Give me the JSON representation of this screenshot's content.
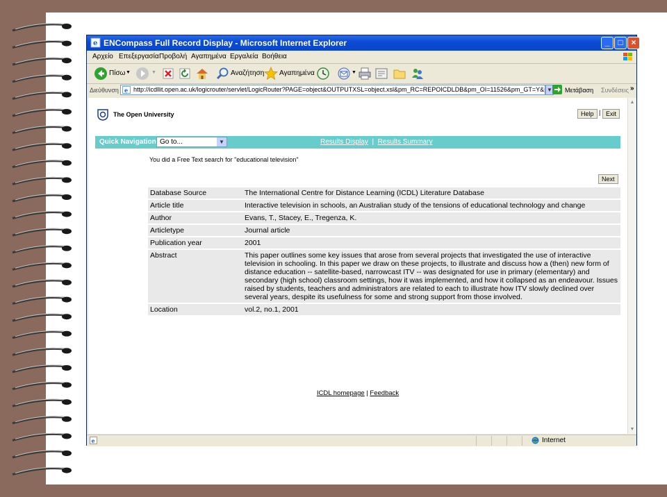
{
  "window": {
    "title": "ENCompass Full Record Display - Microsoft Internet Explorer"
  },
  "menu": [
    "Αρχείο",
    "Επεξεργασία",
    "Προβολή",
    "Αγαπημένα",
    "Εργαλεία",
    "Βοήθεια"
  ],
  "toolbar": {
    "back_label": "Πίσω",
    "search_label": "Αναζήτηση",
    "favorites_label": "Αγαπημένα"
  },
  "address": {
    "label": "Διεύθυνση",
    "url": "http://icdllit.open.ac.uk/logicrouter/servlet/LogicRouter?PAGE=object&OUTPUTXSL=object.xsl&pm_RC=REPOICDLDB&pm_OI=11526&pm_GT=Y&pm_IAC=Y",
    "go_label": "Μετάβαση",
    "links_label": "Συνδέσεις",
    "more_label": "»"
  },
  "header": {
    "org_name": "The Open University",
    "help_label": "Help",
    "exit_label": "Exit",
    "btn_separator": "|"
  },
  "quicknav": {
    "label": "Quick Navigation:",
    "select_value": "Go to...",
    "link_results_display": "Results Display",
    "link_separator": "|",
    "link_results_summary": "Results Summary"
  },
  "search_message": "You did a Free Text search for \"educational television\"",
  "next_label": "Next",
  "record": [
    {
      "field": "Database Source",
      "value": "The International Centre for Distance Learning (ICDL) Literature Database"
    },
    {
      "field": "Article title",
      "value": "Interactive television in schools, an Australian study of the tensions of educational technology and change"
    },
    {
      "field": "Author",
      "value": "Evans, T., Stacey, E., Tregenza, K."
    },
    {
      "field": "Articletype",
      "value": "Journal article"
    },
    {
      "field": "Publication year",
      "value": "2001"
    },
    {
      "field": "Abstract",
      "value": "This paper outlines some key issues that arose from several projects that investigated the use of interactive television in schooling. In this paper we draw on these projects, to illustrate and discuss how a (then) new form of distance education -- satellite-based, narrowcast ITV -- was designated for use in primary (elementary) and secondary (high school) classroom settings, how it was implemented, and how it collapsed as an endeavour. Issues raised by students, teachers and administrators are related to each to illustrate how ITV slowly declined over several years, despite its usefulness for some and strong support from those involved."
    },
    {
      "field": "Location",
      "value": "vol.2, no.1, 2001"
    }
  ],
  "footer": {
    "homepage_label": "ICDL homepage",
    "separator": "|",
    "feedback_label": "Feedback"
  },
  "status": {
    "zone": "Internet"
  }
}
